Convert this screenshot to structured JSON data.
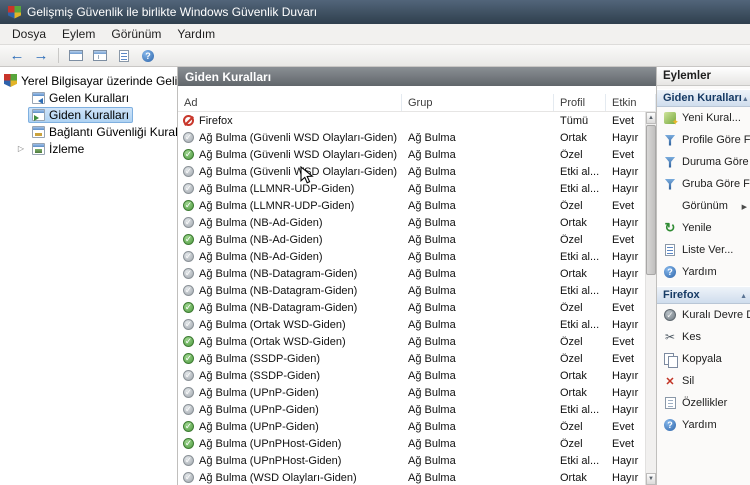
{
  "window": {
    "title": "Gelişmiş Güvenlik ile birlikte Windows Güvenlik Duvarı"
  },
  "menubar": {
    "items": [
      "Dosya",
      "Eylem",
      "Görünüm",
      "Yardım"
    ]
  },
  "toolbar": {
    "buttons": [
      "back-arrow",
      "forward-arrow",
      "console-window",
      "console-panes",
      "export-list",
      "help"
    ]
  },
  "colors": {
    "titlebar": "#3d4f60",
    "selection": "#bcd8f2",
    "rule_allow": "#4f9b40",
    "rule_disabled": "#9fa6ac",
    "rule_block": "#c8372b",
    "panel_header": "#6e7378"
  },
  "tree": {
    "root_label": "Yerel Bilgisayar üzerinde Gelişm",
    "items": [
      {
        "id": "gelen-kurallari",
        "label": "Gelen Kuralları",
        "icon": "inbound",
        "selected": false,
        "expandable": false
      },
      {
        "id": "giden-kurallari",
        "label": "Giden Kuralları",
        "icon": "outbound",
        "selected": true,
        "expandable": false
      },
      {
        "id": "baglanti-guvenligi",
        "label": "Bağlantı Güvenliği Kuralları",
        "icon": "connsec",
        "selected": false,
        "expandable": false
      },
      {
        "id": "izleme",
        "label": "İzleme",
        "icon": "monitor",
        "selected": false,
        "expandable": true
      }
    ]
  },
  "list": {
    "title": "Giden Kuralları",
    "columns": [
      "Ad",
      "Grup",
      "Profil",
      "Etkin"
    ],
    "rows": [
      {
        "name": "Firefox",
        "group": "",
        "profile": "Tümü",
        "enabled": "Evet",
        "icon": "block"
      },
      {
        "name": "Ağ Bulma (Güvenli WSD Olayları-Giden)",
        "group": "Ağ Bulma",
        "profile": "Ortak",
        "enabled": "Hayır",
        "icon": "disabled"
      },
      {
        "name": "Ağ Bulma (Güvenli WSD Olayları-Giden)",
        "group": "Ağ Bulma",
        "profile": "Özel",
        "enabled": "Evet",
        "icon": "allow"
      },
      {
        "name": "Ağ Bulma (Güvenli WSD Olayları-Giden)",
        "group": "Ağ Bulma",
        "profile": "Etki al...",
        "enabled": "Hayır",
        "icon": "disabled"
      },
      {
        "name": "Ağ Bulma (LLMNR-UDP-Giden)",
        "group": "Ağ Bulma",
        "profile": "Etki al...",
        "enabled": "Hayır",
        "icon": "disabled"
      },
      {
        "name": "Ağ Bulma (LLMNR-UDP-Giden)",
        "group": "Ağ Bulma",
        "profile": "Özel",
        "enabled": "Evet",
        "icon": "allow"
      },
      {
        "name": "Ağ Bulma (NB-Ad-Giden)",
        "group": "Ağ Bulma",
        "profile": "Ortak",
        "enabled": "Hayır",
        "icon": "disabled"
      },
      {
        "name": "Ağ Bulma (NB-Ad-Giden)",
        "group": "Ağ Bulma",
        "profile": "Özel",
        "enabled": "Evet",
        "icon": "allow"
      },
      {
        "name": "Ağ Bulma (NB-Ad-Giden)",
        "group": "Ağ Bulma",
        "profile": "Etki al...",
        "enabled": "Hayır",
        "icon": "disabled"
      },
      {
        "name": "Ağ Bulma (NB-Datagram-Giden)",
        "group": "Ağ Bulma",
        "profile": "Ortak",
        "enabled": "Hayır",
        "icon": "disabled"
      },
      {
        "name": "Ağ Bulma (NB-Datagram-Giden)",
        "group": "Ağ Bulma",
        "profile": "Etki al...",
        "enabled": "Hayır",
        "icon": "disabled"
      },
      {
        "name": "Ağ Bulma (NB-Datagram-Giden)",
        "group": "Ağ Bulma",
        "profile": "Özel",
        "enabled": "Evet",
        "icon": "allow"
      },
      {
        "name": "Ağ Bulma (Ortak WSD-Giden)",
        "group": "Ağ Bulma",
        "profile": "Etki al...",
        "enabled": "Hayır",
        "icon": "disabled"
      },
      {
        "name": "Ağ Bulma (Ortak WSD-Giden)",
        "group": "Ağ Bulma",
        "profile": "Özel",
        "enabled": "Evet",
        "icon": "allow"
      },
      {
        "name": "Ağ Bulma (SSDP-Giden)",
        "group": "Ağ Bulma",
        "profile": "Özel",
        "enabled": "Evet",
        "icon": "allow"
      },
      {
        "name": "Ağ Bulma (SSDP-Giden)",
        "group": "Ağ Bulma",
        "profile": "Ortak",
        "enabled": "Hayır",
        "icon": "disabled"
      },
      {
        "name": "Ağ Bulma (UPnP-Giden)",
        "group": "Ağ Bulma",
        "profile": "Ortak",
        "enabled": "Hayır",
        "icon": "disabled"
      },
      {
        "name": "Ağ Bulma (UPnP-Giden)",
        "group": "Ağ Bulma",
        "profile": "Etki al...",
        "enabled": "Hayır",
        "icon": "disabled"
      },
      {
        "name": "Ağ Bulma (UPnP-Giden)",
        "group": "Ağ Bulma",
        "profile": "Özel",
        "enabled": "Evet",
        "icon": "allow"
      },
      {
        "name": "Ağ Bulma (UPnPHost-Giden)",
        "group": "Ağ Bulma",
        "profile": "Özel",
        "enabled": "Evet",
        "icon": "allow"
      },
      {
        "name": "Ağ Bulma (UPnPHost-Giden)",
        "group": "Ağ Bulma",
        "profile": "Etki al...",
        "enabled": "Hayır",
        "icon": "disabled"
      },
      {
        "name": "Ağ Bulma (WSD Olayları-Giden)",
        "group": "Ağ Bulma",
        "profile": "Ortak",
        "enabled": "Hayır",
        "icon": "disabled"
      }
    ]
  },
  "actions": {
    "title": "Eylemler",
    "sections": [
      {
        "header": "Giden Kuralları",
        "items": [
          {
            "label": "Yeni Kural...",
            "icon": "new-rule",
            "submenu": false
          },
          {
            "label": "Profile Göre Fil...",
            "icon": "filter",
            "submenu": false
          },
          {
            "label": "Duruma Göre F...",
            "icon": "filter",
            "submenu": false
          },
          {
            "label": "Gruba Göre Fil...",
            "icon": "filter",
            "submenu": false
          },
          {
            "label": "Görünüm",
            "icon": "none",
            "submenu": true
          },
          {
            "label": "Yenile",
            "icon": "refresh",
            "submenu": false
          },
          {
            "label": "Liste Ver...",
            "icon": "export",
            "submenu": false
          },
          {
            "label": "Yardım",
            "icon": "help",
            "submenu": false
          }
        ]
      },
      {
        "header": "Firefox",
        "items": [
          {
            "label": "Kuralı Devre Dı...",
            "icon": "disable",
            "submenu": false
          },
          {
            "label": "Kes",
            "icon": "cut",
            "submenu": false
          },
          {
            "label": "Kopyala",
            "icon": "copy",
            "submenu": false
          },
          {
            "label": "Sil",
            "icon": "delete",
            "submenu": false
          },
          {
            "label": "Özellikler",
            "icon": "properties",
            "submenu": false
          },
          {
            "label": "Yardım",
            "icon": "help",
            "submenu": false
          }
        ]
      }
    ]
  }
}
